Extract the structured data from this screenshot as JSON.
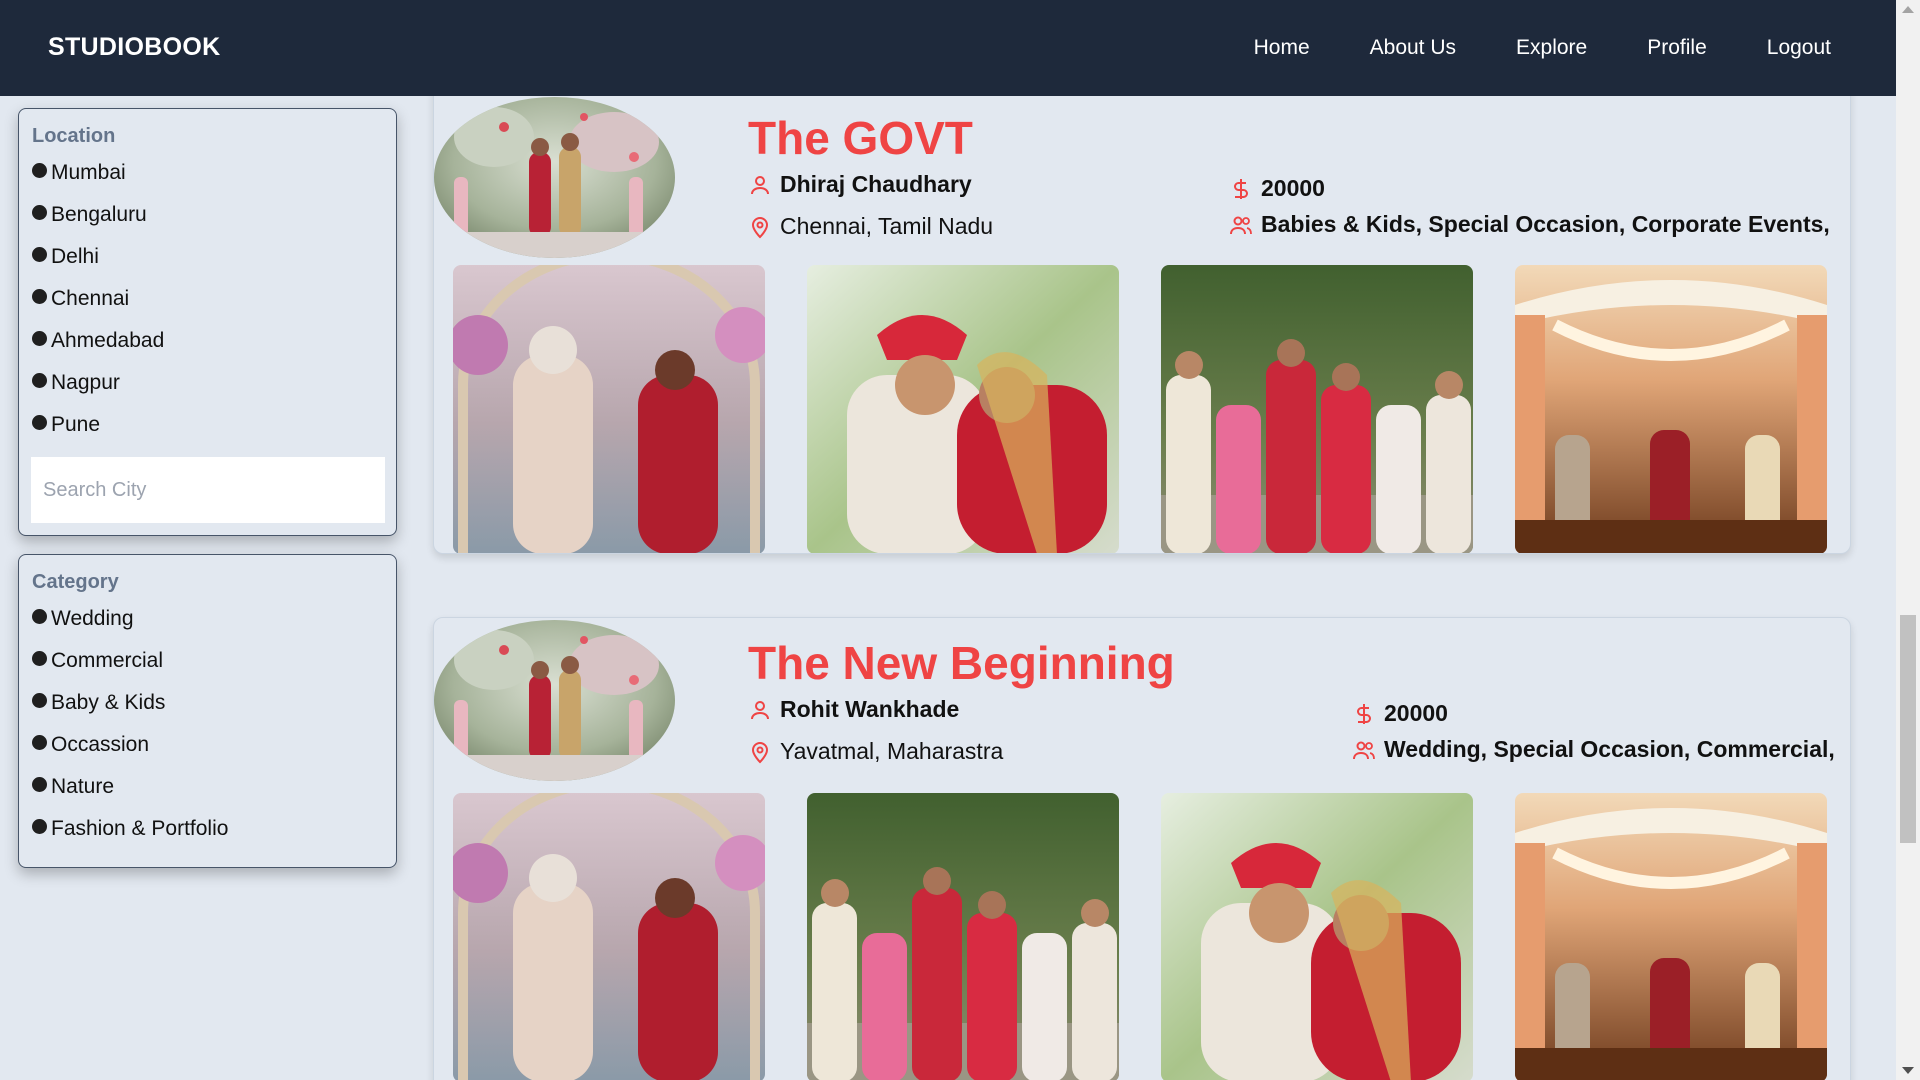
{
  "navbar": {
    "brand": "STUDIOBOOK",
    "links": [
      "Home",
      "About Us",
      "Explore",
      "Profile",
      "Logout"
    ]
  },
  "filters": {
    "location": {
      "title": "Location",
      "options": [
        "Mumbai",
        "Bengaluru",
        "Delhi",
        "Chennai",
        "Ahmedabad",
        "Nagpur",
        "Pune"
      ],
      "search_placeholder": "Search City"
    },
    "category": {
      "title": "Category",
      "options": [
        "Wedding",
        "Commercial",
        "Baby & Kids",
        "Occassion",
        "Nature",
        "Fashion & Portfolio"
      ]
    }
  },
  "studios": [
    {
      "name": "The GOVT",
      "owner": "Dhiraj Chaudhary",
      "location": "Chennai, Tamil Nadu",
      "price": "20000",
      "categories": "Babies & Kids, Special Occasion, Corporate Events,"
    },
    {
      "name": "The New Beginning",
      "owner": "Rohit Wankhade",
      "location": "Yavatmal, Maharastra",
      "price": "20000",
      "categories": "Wedding, Special Occasion, Commercial,"
    }
  ],
  "icons": {
    "user": "user-icon",
    "location": "location-pin-icon",
    "price": "dollar-icon",
    "categories": "users-icon"
  },
  "colors": {
    "navbar": "#1e293b",
    "accent": "#ef4444",
    "page_bg": "#e2e8f0"
  }
}
